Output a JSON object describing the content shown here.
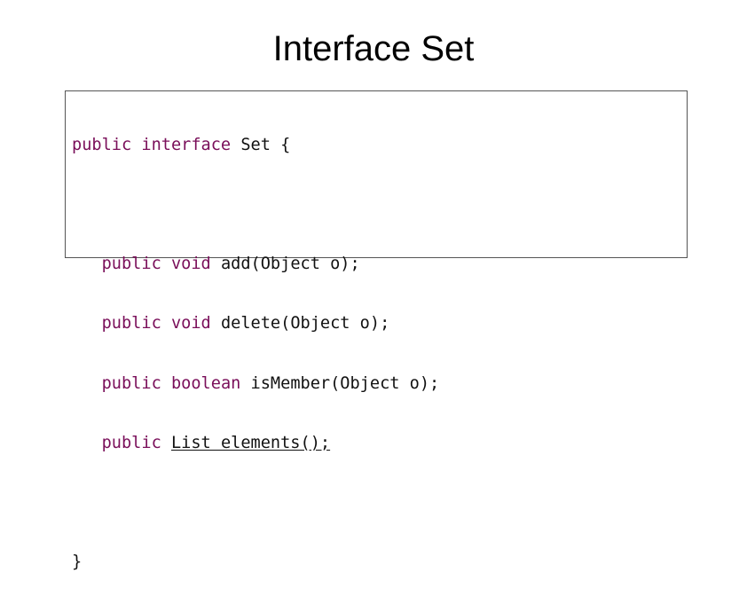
{
  "title": "Interface Set",
  "colors": {
    "keyword": "#7a0f5a",
    "text": "#111111",
    "border": "#555555"
  },
  "code": {
    "line1": {
      "kw1": "public",
      "kw2": "interface",
      "rest": "Set {"
    },
    "line3": {
      "indent": "   ",
      "kw1": "public",
      "kw2": "void",
      "rest": "add(Object o);"
    },
    "line4": {
      "indent": "   ",
      "kw1": "public",
      "kw2": "void",
      "rest": "delete(Object o);"
    },
    "line5": {
      "indent": "   ",
      "kw1": "public",
      "kw2": "boolean",
      "rest": "isMember(Object o);"
    },
    "line6": {
      "indent": "   ",
      "kw1": "public",
      "rest": "List elements();"
    },
    "line8": {
      "rest": "}"
    }
  }
}
